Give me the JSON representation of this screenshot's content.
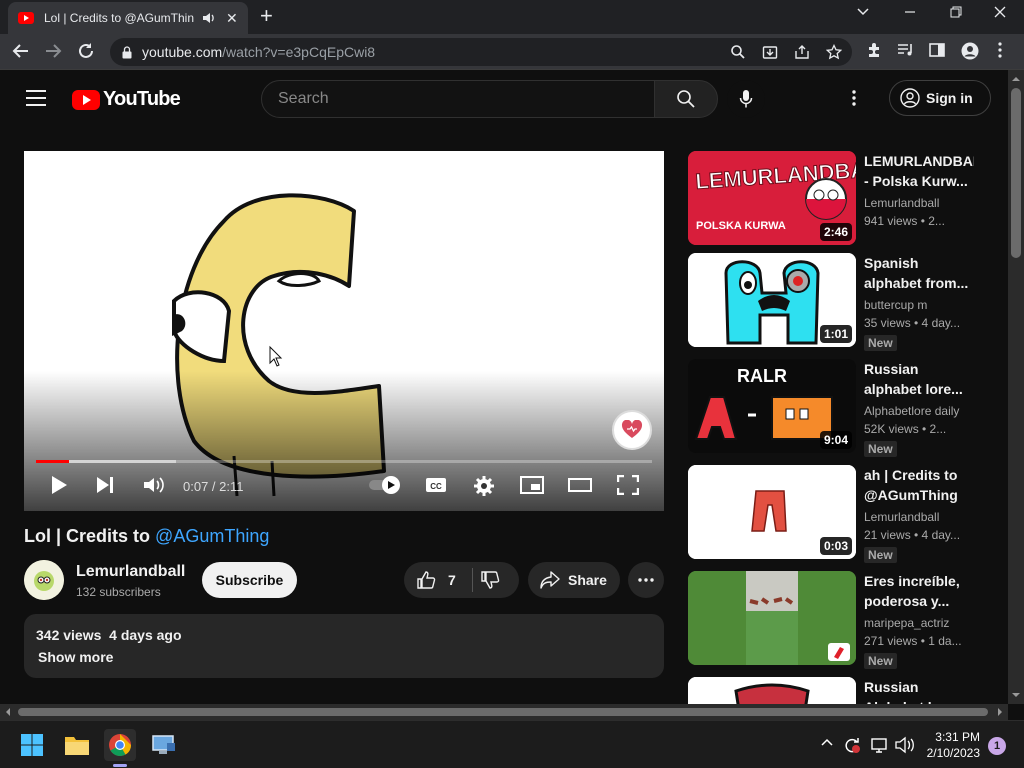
{
  "browser": {
    "tab_title": "Lol | Credits to @AGumThing",
    "url_host": "youtube.com",
    "url_path": "/watch?v=e3pCqEpCwi8"
  },
  "header": {
    "logo_text": "YouTube",
    "search_placeholder": "Search",
    "signin_label": "Sign in"
  },
  "player": {
    "time": "0:07 / 2:11",
    "progress_fraction": 0.054
  },
  "video": {
    "title": "Lol | Credits to ",
    "title_mention": "@AGumThing",
    "channel": "Lemurlandball",
    "subscribers": "132 subscribers",
    "subscribe_label": "Subscribe",
    "likes": "7",
    "share_label": "Share",
    "stats": "342 views  4 days ago",
    "show_more": "Show more"
  },
  "recommendations": [
    {
      "title": "LEMURLANDBALL - Polska Kurw...",
      "channel": "Lemurlandball",
      "stats": "941 views  • 2...",
      "duration": "2:46",
      "new": "",
      "thumb_text": "LEMURLANDBALL",
      "thumb_sub": "POLSKA KURWA"
    },
    {
      "title": "Spanish alphabet from...",
      "channel": "buttercup m",
      "stats": "35 views  • 4 day...",
      "duration": "1:01",
      "new": "New",
      "thumb_text": "",
      "thumb_sub": ""
    },
    {
      "title": "Russian alphabet lore...",
      "channel": "Alphabetlore daily",
      "stats": "52K views  • 2...",
      "duration": "9:04",
      "new": "New",
      "thumb_text": "RALR",
      "thumb_sub": ""
    },
    {
      "title": "ah | Credits to @AGumThing",
      "channel": "Lemurlandball",
      "stats": "21 views  • 4 day...",
      "duration": "0:03",
      "new": "New",
      "thumb_text": "",
      "thumb_sub": ""
    },
    {
      "title": "Eres increíble, poderosa y...",
      "channel": "maripepa_actriz",
      "stats": "271 views  • 1 da...",
      "duration": "",
      "new": "New",
      "thumb_text": "",
      "thumb_sub": ""
    },
    {
      "title": "Russian Alphabet l...",
      "channel": "",
      "stats": "",
      "duration": "",
      "new": "",
      "thumb_text": "",
      "thumb_sub": ""
    }
  ],
  "taskbar": {
    "time": "3:31 PM",
    "date": "2/10/2023",
    "notifications": "1"
  },
  "colors": {
    "accent_red": "#ff0000",
    "link_blue": "#3ea6ff",
    "bg": "#0f0f0f"
  }
}
